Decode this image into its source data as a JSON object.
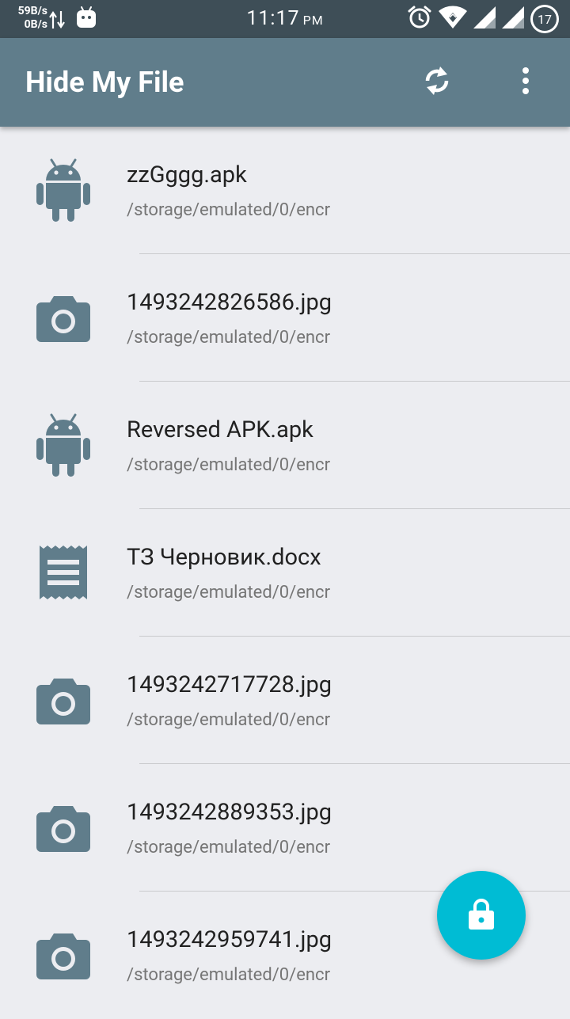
{
  "status_bar": {
    "net_up": "59B/s",
    "net_down": "0B/s",
    "time": "11:17",
    "ampm": "PM",
    "battery": "17"
  },
  "app_bar": {
    "title": "Hide My File",
    "sync_icon": "sync-icon",
    "overflow_icon": "more-vert-icon"
  },
  "files": [
    {
      "name": "zzGggg.apk",
      "path": "/storage/emulated/0/encr",
      "icon": "android-icon"
    },
    {
      "name": "1493242826586.jpg",
      "path": "/storage/emulated/0/encr",
      "icon": "camera-icon"
    },
    {
      "name": "Reversed APK.apk",
      "path": "/storage/emulated/0/encr",
      "icon": "android-icon"
    },
    {
      "name": "ТЗ Черновик.docx",
      "path": "/storage/emulated/0/encr",
      "icon": "receipt-document-icon"
    },
    {
      "name": "1493242717728.jpg",
      "path": "/storage/emulated/0/encr",
      "icon": "camera-icon"
    },
    {
      "name": "1493242889353.jpg",
      "path": "/storage/emulated/0/encr",
      "icon": "camera-icon"
    },
    {
      "name": "1493242959741.jpg",
      "path": "/storage/emulated/0/encr",
      "icon": "camera-icon"
    }
  ],
  "fab": {
    "icon": "lock-icon"
  },
  "colors": {
    "status_bar": "#3e4e57",
    "app_bar": "#607d8b",
    "icon": "#607d8b",
    "fab": "#00bcd4",
    "background": "#ecedf1"
  }
}
